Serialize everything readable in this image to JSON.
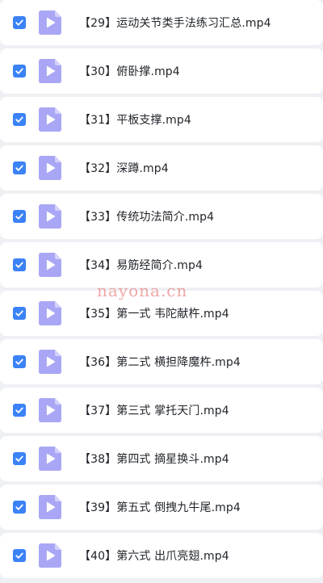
{
  "colors": {
    "checkbox": "#3b82f6",
    "file_icon": "#a9a7f5",
    "file_icon_fold": "#d3d1fb",
    "row_background": "#ffffff",
    "list_background": "#eef0f4"
  },
  "icons": {
    "checkbox": "checkmark-icon",
    "file": "video-file-play-icon"
  },
  "files": [
    {
      "name": "【29】运动关节类手法练习汇总.mp4",
      "checked": true
    },
    {
      "name": "【30】俯卧撑.mp4",
      "checked": true
    },
    {
      "name": "【31】平板支撑.mp4",
      "checked": true
    },
    {
      "name": "【32】深蹲.mp4",
      "checked": true
    },
    {
      "name": "【33】传统功法简介.mp4",
      "checked": true
    },
    {
      "name": "【34】易筋经简介.mp4",
      "checked": true
    },
    {
      "name": "【35】第一式 韦陀献杵.mp4",
      "checked": true
    },
    {
      "name": "【36】第二式 横担降魔杵.mp4",
      "checked": true
    },
    {
      "name": "【37】第三式 掌托天门.mp4",
      "checked": true
    },
    {
      "name": "【38】第四式 摘星换斗.mp4",
      "checked": true
    },
    {
      "name": "【39】第五式 倒拽九牛尾.mp4",
      "checked": true
    },
    {
      "name": "【40】第六式 出爪亮翅.mp4",
      "checked": true
    }
  ],
  "watermark": "nayona.cn"
}
